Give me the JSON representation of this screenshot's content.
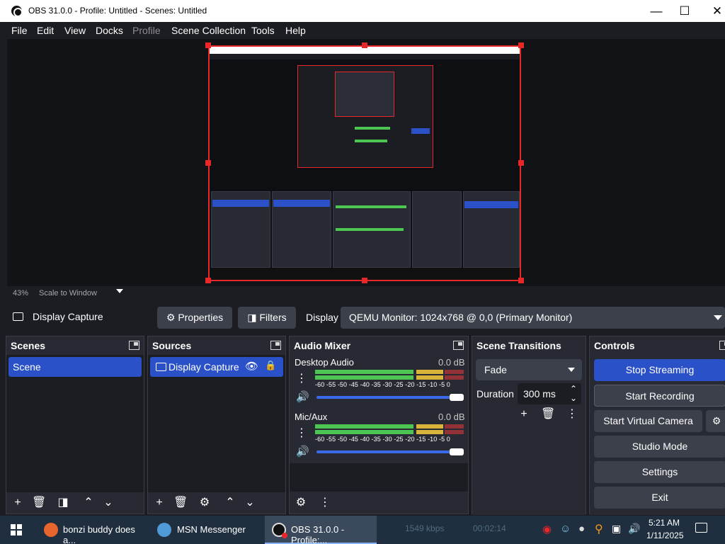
{
  "window": {
    "title": "OBS 31.0.0 - Profile: Untitled - Scenes: Untitled"
  },
  "menu": [
    "File",
    "Edit",
    "View",
    "Docks",
    "Profile",
    "Scene Collection",
    "Tools",
    "Help"
  ],
  "scale": {
    "percent": "43%",
    "mode": "Scale to Window"
  },
  "source_toolbar": {
    "source": "Display Capture",
    "properties": "Properties",
    "filters": "Filters",
    "display_label": "Display",
    "display_value": "QEMU Monitor: 1024x768 @ 0,0 (Primary Monitor)"
  },
  "docks": {
    "scenes": {
      "title": "Scenes",
      "items": [
        "Scene"
      ]
    },
    "sources": {
      "title": "Sources",
      "items": [
        "Display Capture"
      ]
    },
    "mixer": {
      "title": "Audio Mixer",
      "channels": [
        {
          "name": "Desktop Audio",
          "db": "0.0 dB",
          "level": 0.78
        },
        {
          "name": "Mic/Aux",
          "db": "0.0 dB",
          "level": 0.76
        }
      ],
      "ticks": "-60 -55 -50 -45 -40 -35 -30 -25 -20 -15 -10  -5   0"
    },
    "transitions": {
      "title": "Scene Transitions",
      "type": "Fade",
      "duration_label": "Duration",
      "duration": "300 ms"
    },
    "controls": {
      "title": "Controls",
      "buttons": [
        "Stop Streaming",
        "Start Recording",
        "Start Virtual Camera",
        "Studio Mode",
        "Settings",
        "Exit"
      ]
    }
  },
  "taskbar": {
    "items": [
      "bonzi buddy does a...",
      "MSN Messenger",
      "OBS 31.0.0 - Profile:..."
    ],
    "stats": {
      "bitrate": "1549 kbps",
      "time": "00:02:14"
    },
    "clock": {
      "time": "5:21 AM",
      "date": "1/11/2025"
    }
  },
  "colors": {
    "accent": "#2a51c8",
    "record_red": "#e82828",
    "background": "#1c1d22"
  }
}
